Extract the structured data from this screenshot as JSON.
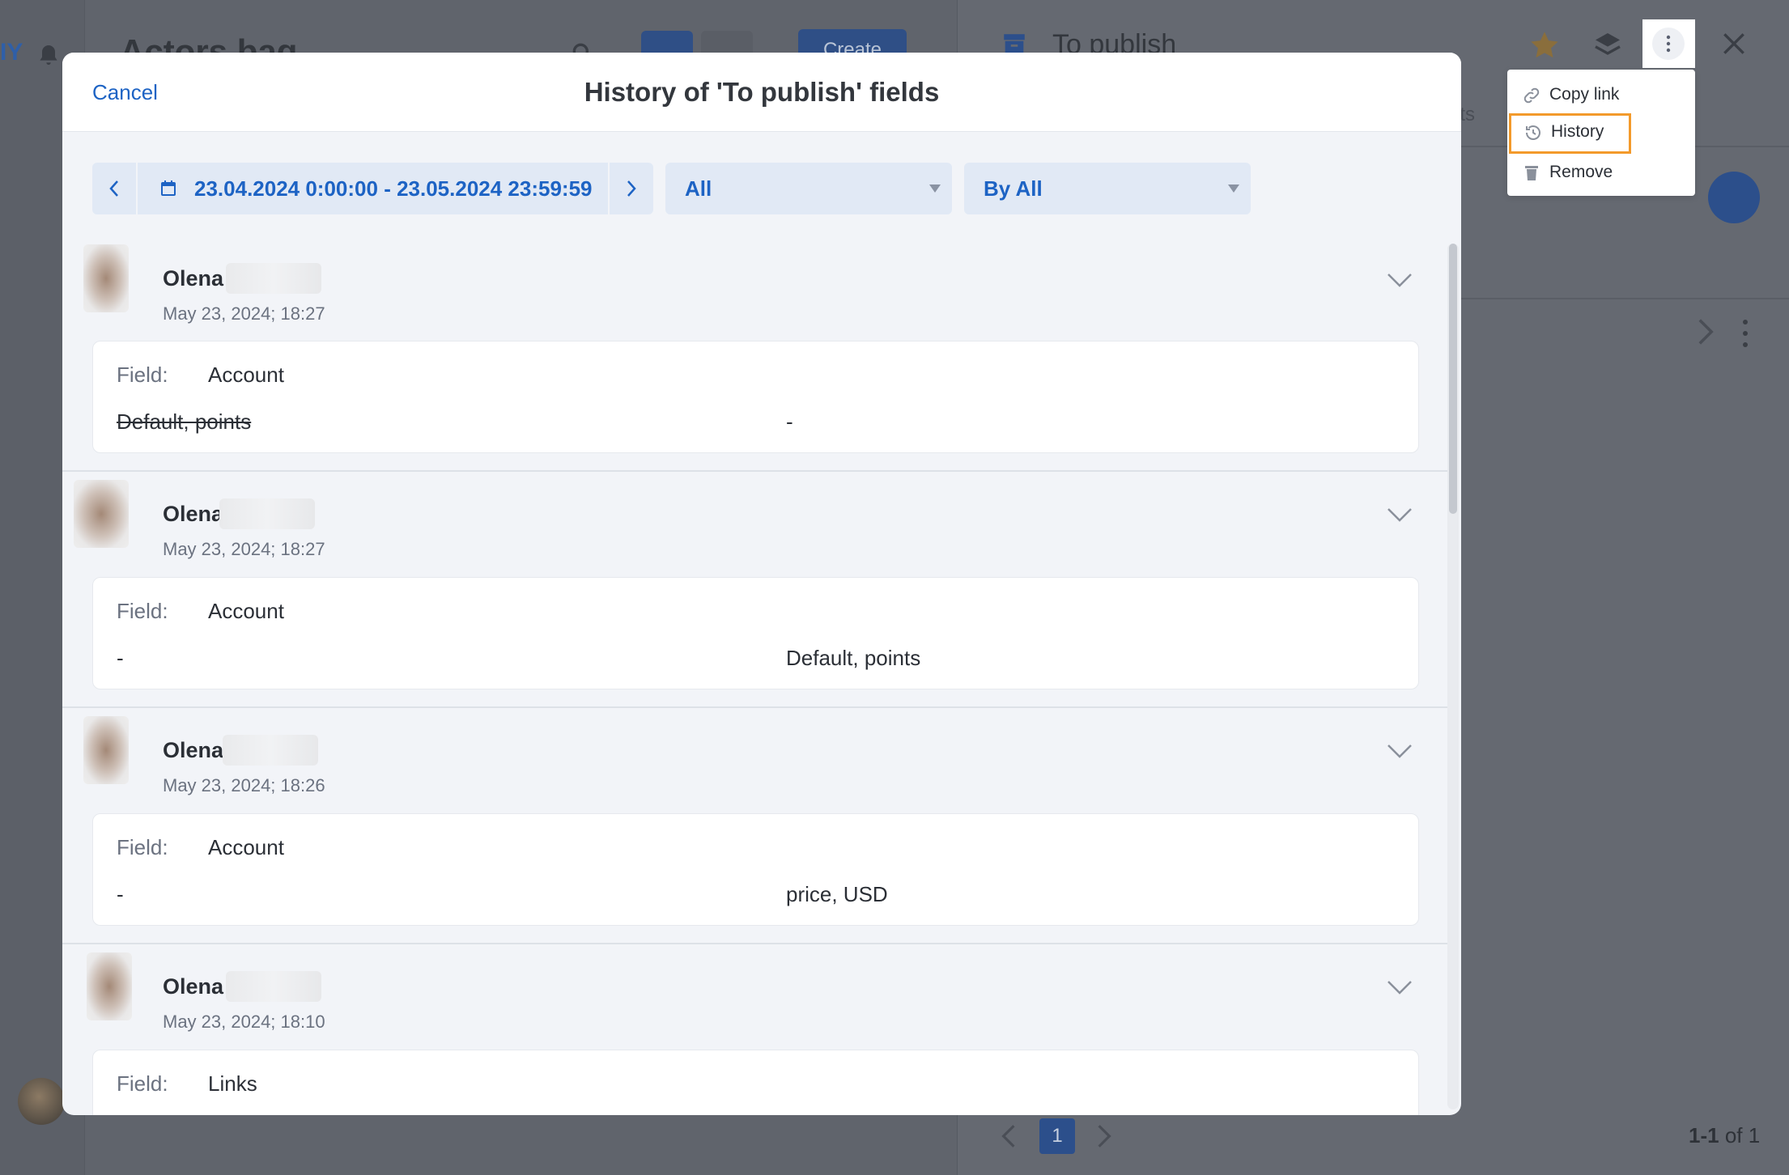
{
  "background": {
    "brand_fragment": "IY",
    "page_title": "Actors bag",
    "create_button": "Create",
    "right_panel_title": "To publish",
    "right_panel_tab_fragment": "nts",
    "pagination": {
      "page": "1",
      "count_range": "1-1",
      "count_of": "of 1"
    }
  },
  "modal": {
    "cancel_label": "Cancel",
    "title": "History of 'To publish' fields",
    "filters": {
      "date_range": "23.04.2024 0:00:00 - 23.05.2024 23:59:59",
      "type_selected": "All",
      "user_selected": "By All"
    },
    "field_prefix": "Field:",
    "entries": [
      {
        "user": "Olena",
        "time": "May 23, 2024; 18:27",
        "field": "Account",
        "old_value": "Default, points",
        "new_value": "-"
      },
      {
        "user": "Olena",
        "time": "May 23, 2024; 18:27",
        "field": "Account",
        "old_value": "-",
        "new_value": "Default, points"
      },
      {
        "user": "Olena",
        "time": "May 23, 2024; 18:26",
        "field": "Account",
        "old_value": "-",
        "new_value": "price, USD"
      },
      {
        "user": "Olena",
        "time": "May 23, 2024; 18:10",
        "field": "Links",
        "old_value": "",
        "new_value": ""
      }
    ]
  },
  "menu": {
    "items": [
      {
        "label": "Copy link",
        "icon": "link-icon"
      },
      {
        "label": "History",
        "icon": "history-icon"
      },
      {
        "label": "Remove",
        "icon": "trash-icon"
      }
    ],
    "highlight_color": "#f39a2b"
  },
  "colors": {
    "accent": "#1d63c4",
    "star": "#e0a23a"
  }
}
